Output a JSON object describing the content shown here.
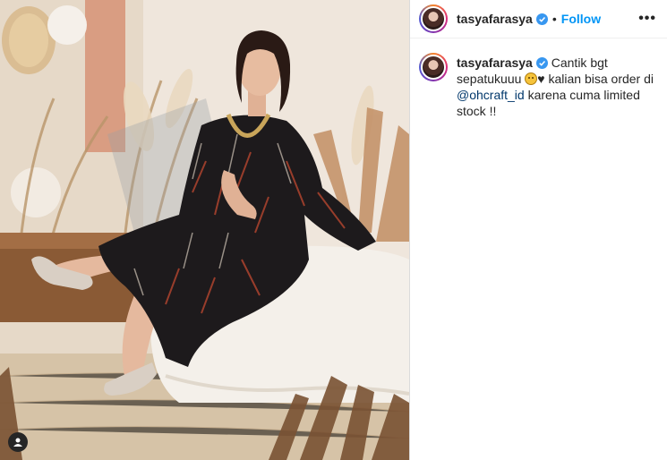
{
  "post": {
    "username": "tasyafarasya",
    "follow_label": "Follow",
    "separator": "•",
    "more_icon": "•••"
  },
  "caption": {
    "username": "tasyafarasya",
    "text_part1": " Cantik bgt sepatukuuu ",
    "heart": "♥",
    "text_part2": " kalian bisa order di ",
    "mention": "@ohcraft_id",
    "text_part3": " karena cuma limited stock !!"
  },
  "colors": {
    "follow": "#0095f6",
    "verified": "#3897f0",
    "mention": "#00376b"
  }
}
